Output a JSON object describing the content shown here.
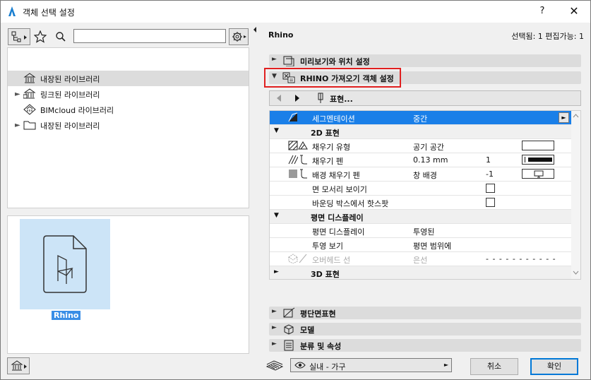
{
  "window": {
    "title": "객체 선택 설정",
    "help_label": "?",
    "close_label": "✕"
  },
  "left": {
    "search_value": "",
    "tree": [
      {
        "label": "내장된 라이브러리",
        "expandable": false,
        "selected": true
      },
      {
        "label": "링크된 라이브러리",
        "expandable": true,
        "selected": false
      },
      {
        "label": "BIMcloud 라이브러리",
        "expandable": false,
        "selected": false
      },
      {
        "label": "내장된 라이브러리",
        "expandable": true,
        "selected": false
      }
    ],
    "preview_name": "Rhino"
  },
  "right": {
    "title": "Rhino",
    "status": "선택됨: 1 편집가능: 1",
    "panels": {
      "preview_position": "미리보기와 위치 설정",
      "rhino_import": "RHINO 가져오기 객체 설정",
      "floor_plan_section": "평단면표현",
      "model": "모델",
      "classification": "분류 및 속성"
    },
    "nav_label": "표현...",
    "rows": {
      "segmentation": {
        "name": "세그멘테이션",
        "value": "중간"
      },
      "group_2d": "2D 표현",
      "fill_type": {
        "name": "채우기 유형",
        "value": "공기 공간"
      },
      "fill_pen": {
        "name": "채우기 펜",
        "value": "0.13 mm",
        "num": "1"
      },
      "bg_pen": {
        "name": "배경 채우기 펜",
        "value": "창 배경",
        "num": "-1"
      },
      "show_edges": {
        "name": "면 모서리 보이기"
      },
      "hotspot_box": {
        "name": "바운딩 박스에서 핫스팟"
      },
      "group_plan": "평면 디스플레이",
      "plan_display": {
        "name": "평면 디스플레이",
        "value": "투영된"
      },
      "projection": {
        "name": "투영 보기",
        "value": "평면 범위에"
      },
      "overhead": {
        "name": "오버헤드 선",
        "value": "은선"
      },
      "group_3d": "3D 표현"
    },
    "footer": {
      "combo_label": "실내 - 가구",
      "cancel_label": "취소",
      "ok_label": "확인"
    }
  },
  "colors": {
    "selection_blue": "#1a7fe8",
    "highlight_red": "#e02020",
    "preview_bg": "#cce4f7"
  }
}
